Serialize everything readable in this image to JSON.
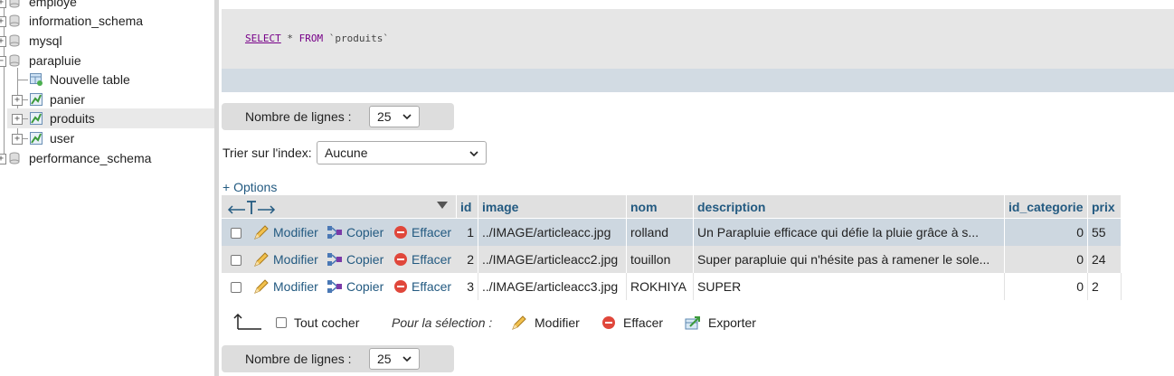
{
  "nav": {
    "items": [
      {
        "label": "employe",
        "type": "db"
      },
      {
        "label": "information_schema",
        "type": "db"
      },
      {
        "label": "mysql",
        "type": "db"
      },
      {
        "label": "parapluie",
        "type": "db"
      },
      {
        "label": "Nouvelle table",
        "type": "new"
      },
      {
        "label": "panier",
        "type": "table"
      },
      {
        "label": "produits",
        "type": "table",
        "active": true
      },
      {
        "label": "user",
        "type": "table"
      },
      {
        "label": "performance_schema",
        "type": "db"
      }
    ]
  },
  "query": {
    "select": "SELECT",
    "star": "*",
    "from": "FROM",
    "table": "`produits`"
  },
  "rows_control": {
    "label": "Nombre de lignes :",
    "value": "25"
  },
  "sort": {
    "label": "Trier sur l'index:",
    "value": "Aucune"
  },
  "options_link": "+ Options",
  "table": {
    "columns": [
      "id",
      "image",
      "nom",
      "description",
      "id_categorie",
      "prix"
    ],
    "actions": {
      "edit": "Modifier",
      "copy": "Copier",
      "delete": "Effacer"
    },
    "rows": [
      {
        "id": "1",
        "image": "../IMAGE/articleacc.jpg",
        "nom": "rolland",
        "description": "Un Parapluie efficace qui défie la pluie grâce à s...",
        "id_categorie": "0",
        "prix": "55"
      },
      {
        "id": "2",
        "image": "../IMAGE/articleacc2.jpg",
        "nom": "touillon",
        "description": "Super parapluie qui n'hésite pas à ramener le sole...",
        "id_categorie": "0",
        "prix": "24"
      },
      {
        "id": "3",
        "image": "../IMAGE/articleacc3.jpg",
        "nom": "ROKHIYA",
        "description": "SUPER",
        "id_categorie": "0",
        "prix": "2"
      }
    ]
  },
  "selection_bar": {
    "check_all": "Tout cocher",
    "for_selection": "Pour la sélection :",
    "edit": "Modifier",
    "delete": "Effacer",
    "export": "Exporter"
  },
  "colors": {
    "link": "#235a81",
    "row_highlight": "#cdd7e0",
    "sql_keyword": "#770088"
  }
}
